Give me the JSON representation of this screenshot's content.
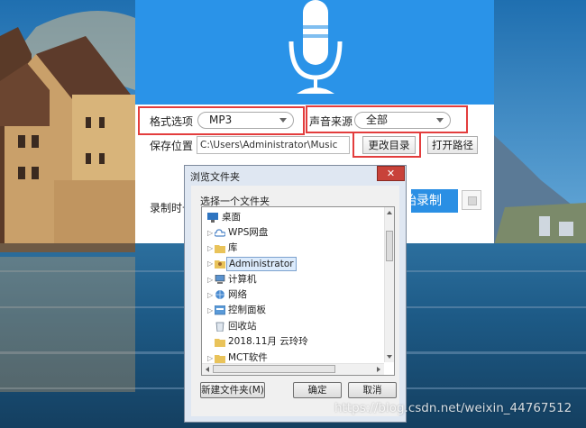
{
  "recorder": {
    "format_label": "格式选项",
    "format_value": "MP3",
    "source_label": "声音来源",
    "source_value": "全部",
    "save_label": "保存位置",
    "save_path": "C:\\Users\\Administrator\\Music",
    "change_dir_label": "更改目录",
    "open_path_label": "打开路径",
    "record_time_label": "录制时长",
    "record_button_label": "开始录制",
    "accent_color": "#2a93e8"
  },
  "dialog": {
    "title": "浏览文件夹",
    "close_glyph": "✕",
    "prompt": "选择一个文件夹",
    "tree_items": [
      {
        "label": "桌面",
        "icon": "desktop-icon"
      },
      {
        "label": "WPS网盘",
        "icon": "cloud-icon"
      },
      {
        "label": "库",
        "icon": "library-folder-icon"
      },
      {
        "label": "Administrator",
        "icon": "user-folder-icon"
      },
      {
        "label": "计算机",
        "icon": "computer-icon"
      },
      {
        "label": "网络",
        "icon": "network-icon"
      },
      {
        "label": "控制面板",
        "icon": "control-panel-icon"
      },
      {
        "label": "回收站",
        "icon": "recycle-bin-icon"
      },
      {
        "label": "2018.11月 云玲玲",
        "icon": "folder-icon"
      },
      {
        "label": "MCT软件",
        "icon": "folder-icon"
      }
    ],
    "new_folder_label": "新建文件夹(M)",
    "ok_label": "确定",
    "cancel_label": "取消"
  },
  "watermark": "https://blog.csdn.net/weixin_44767512"
}
